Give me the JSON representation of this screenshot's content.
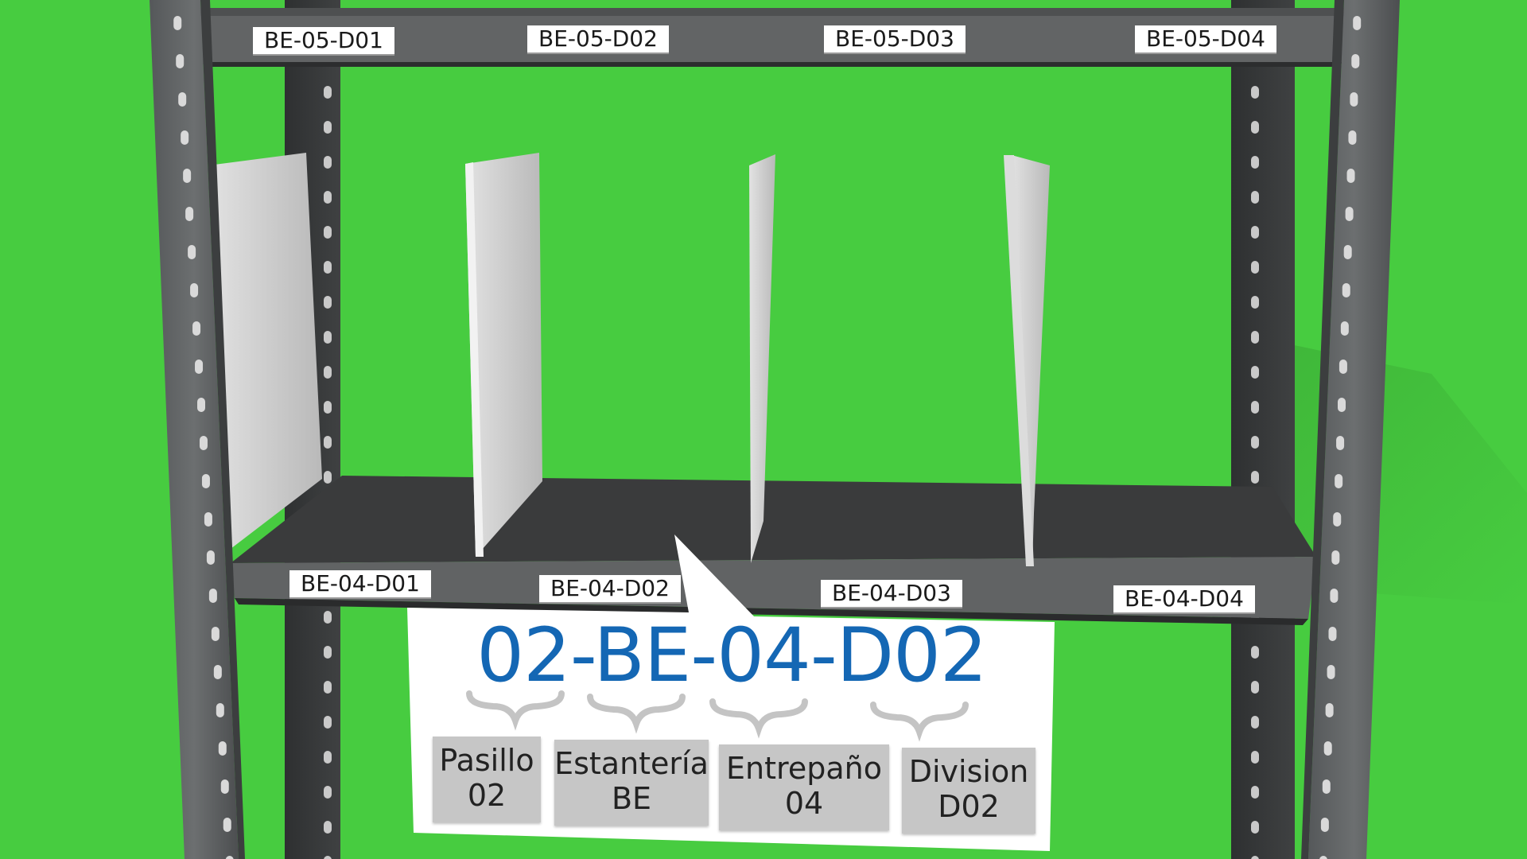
{
  "colors": {
    "background": "#47cc40",
    "shelf_frame": "#616364",
    "shelf_dark": "#3b3c3d",
    "divider": "#c9c9c9",
    "code_text": "#1467b4",
    "part_box": "#c6c6c6"
  },
  "top_shelf_labels": [
    "BE-05-D01",
    "BE-05-D02",
    "BE-05-D03",
    "BE-05-D04"
  ],
  "bottom_shelf_labels": [
    "BE-04-D01",
    "BE-04-D02",
    "BE-04-D03",
    "BE-04-D04"
  ],
  "callout": {
    "code": "02-BE-04-D02",
    "parts": [
      {
        "name": "Pasillo",
        "value": "02"
      },
      {
        "name": "Estantería",
        "value": "BE"
      },
      {
        "name": "Entrepaño",
        "value": "04"
      },
      {
        "name": "Division",
        "value": "D02"
      }
    ]
  }
}
